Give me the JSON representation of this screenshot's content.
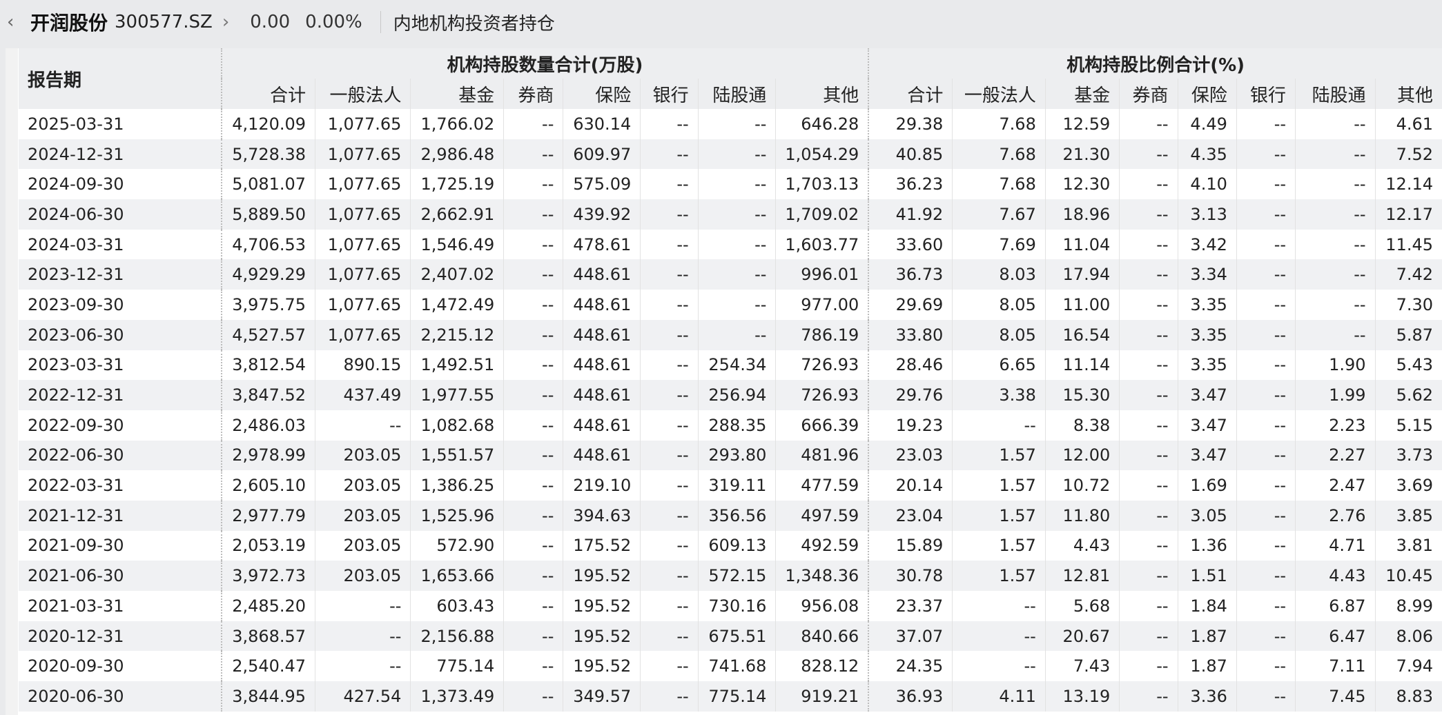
{
  "header": {
    "back_icon": "‹",
    "stock_name": "开润股份",
    "stock_code": "300577.SZ",
    "chevron_icon": "›",
    "price_change": "0.00",
    "percent_change": "0.00%",
    "section_title": "内地机构投资者持仓"
  },
  "table": {
    "period_header": "报告期",
    "group_quantity": "机构持股数量合计(万股)",
    "group_ratio": "机构持股比例合计(%)",
    "columns": [
      "合计",
      "一般法人",
      "基金",
      "券商",
      "保险",
      "银行",
      "陆股通",
      "其他"
    ],
    "rows": [
      [
        "2025-03-31",
        "4,120.09",
        "1,077.65",
        "1,766.02",
        "--",
        "630.14",
        "--",
        "--",
        "646.28",
        "29.38",
        "7.68",
        "12.59",
        "--",
        "4.49",
        "--",
        "--",
        "4.61"
      ],
      [
        "2024-12-31",
        "5,728.38",
        "1,077.65",
        "2,986.48",
        "--",
        "609.97",
        "--",
        "--",
        "1,054.29",
        "40.85",
        "7.68",
        "21.30",
        "--",
        "4.35",
        "--",
        "--",
        "7.52"
      ],
      [
        "2024-09-30",
        "5,081.07",
        "1,077.65",
        "1,725.19",
        "--",
        "575.09",
        "--",
        "--",
        "1,703.13",
        "36.23",
        "7.68",
        "12.30",
        "--",
        "4.10",
        "--",
        "--",
        "12.14"
      ],
      [
        "2024-06-30",
        "5,889.50",
        "1,077.65",
        "2,662.91",
        "--",
        "439.92",
        "--",
        "--",
        "1,709.02",
        "41.92",
        "7.67",
        "18.96",
        "--",
        "3.13",
        "--",
        "--",
        "12.17"
      ],
      [
        "2024-03-31",
        "4,706.53",
        "1,077.65",
        "1,546.49",
        "--",
        "478.61",
        "--",
        "--",
        "1,603.77",
        "33.60",
        "7.69",
        "11.04",
        "--",
        "3.42",
        "--",
        "--",
        "11.45"
      ],
      [
        "2023-12-31",
        "4,929.29",
        "1,077.65",
        "2,407.02",
        "--",
        "448.61",
        "--",
        "--",
        "996.01",
        "36.73",
        "8.03",
        "17.94",
        "--",
        "3.34",
        "--",
        "--",
        "7.42"
      ],
      [
        "2023-09-30",
        "3,975.75",
        "1,077.65",
        "1,472.49",
        "--",
        "448.61",
        "--",
        "--",
        "977.00",
        "29.69",
        "8.05",
        "11.00",
        "--",
        "3.35",
        "--",
        "--",
        "7.30"
      ],
      [
        "2023-06-30",
        "4,527.57",
        "1,077.65",
        "2,215.12",
        "--",
        "448.61",
        "--",
        "--",
        "786.19",
        "33.80",
        "8.05",
        "16.54",
        "--",
        "3.35",
        "--",
        "--",
        "5.87"
      ],
      [
        "2023-03-31",
        "3,812.54",
        "890.15",
        "1,492.51",
        "--",
        "448.61",
        "--",
        "254.34",
        "726.93",
        "28.46",
        "6.65",
        "11.14",
        "--",
        "3.35",
        "--",
        "1.90",
        "5.43"
      ],
      [
        "2022-12-31",
        "3,847.52",
        "437.49",
        "1,977.55",
        "--",
        "448.61",
        "--",
        "256.94",
        "726.93",
        "29.76",
        "3.38",
        "15.30",
        "--",
        "3.47",
        "--",
        "1.99",
        "5.62"
      ],
      [
        "2022-09-30",
        "2,486.03",
        "--",
        "1,082.68",
        "--",
        "448.61",
        "--",
        "288.35",
        "666.39",
        "19.23",
        "--",
        "8.38",
        "--",
        "3.47",
        "--",
        "2.23",
        "5.15"
      ],
      [
        "2022-06-30",
        "2,978.99",
        "203.05",
        "1,551.57",
        "--",
        "448.61",
        "--",
        "293.80",
        "481.96",
        "23.03",
        "1.57",
        "12.00",
        "--",
        "3.47",
        "--",
        "2.27",
        "3.73"
      ],
      [
        "2022-03-31",
        "2,605.10",
        "203.05",
        "1,386.25",
        "--",
        "219.10",
        "--",
        "319.11",
        "477.59",
        "20.14",
        "1.57",
        "10.72",
        "--",
        "1.69",
        "--",
        "2.47",
        "3.69"
      ],
      [
        "2021-12-31",
        "2,977.79",
        "203.05",
        "1,525.96",
        "--",
        "394.63",
        "--",
        "356.56",
        "497.59",
        "23.04",
        "1.57",
        "11.80",
        "--",
        "3.05",
        "--",
        "2.76",
        "3.85"
      ],
      [
        "2021-09-30",
        "2,053.19",
        "203.05",
        "572.90",
        "--",
        "175.52",
        "--",
        "609.13",
        "492.59",
        "15.89",
        "1.57",
        "4.43",
        "--",
        "1.36",
        "--",
        "4.71",
        "3.81"
      ],
      [
        "2021-06-30",
        "3,972.73",
        "203.05",
        "1,653.66",
        "--",
        "195.52",
        "--",
        "572.15",
        "1,348.36",
        "30.78",
        "1.57",
        "12.81",
        "--",
        "1.51",
        "--",
        "4.43",
        "10.45"
      ],
      [
        "2021-03-31",
        "2,485.20",
        "--",
        "603.43",
        "--",
        "195.52",
        "--",
        "730.16",
        "956.08",
        "23.37",
        "--",
        "5.68",
        "--",
        "1.84",
        "--",
        "6.87",
        "8.99"
      ],
      [
        "2020-12-31",
        "3,868.57",
        "--",
        "2,156.88",
        "--",
        "195.52",
        "--",
        "675.51",
        "840.66",
        "37.07",
        "--",
        "20.67",
        "--",
        "1.87",
        "--",
        "6.47",
        "8.06"
      ],
      [
        "2020-09-30",
        "2,540.47",
        "--",
        "775.14",
        "--",
        "195.52",
        "--",
        "741.68",
        "828.12",
        "24.35",
        "--",
        "7.43",
        "--",
        "1.87",
        "--",
        "7.11",
        "7.94"
      ],
      [
        "2020-06-30",
        "3,844.95",
        "427.54",
        "1,373.49",
        "--",
        "349.57",
        "--",
        "775.14",
        "919.21",
        "36.93",
        "4.11",
        "13.19",
        "--",
        "3.36",
        "--",
        "7.45",
        "8.83"
      ]
    ]
  }
}
